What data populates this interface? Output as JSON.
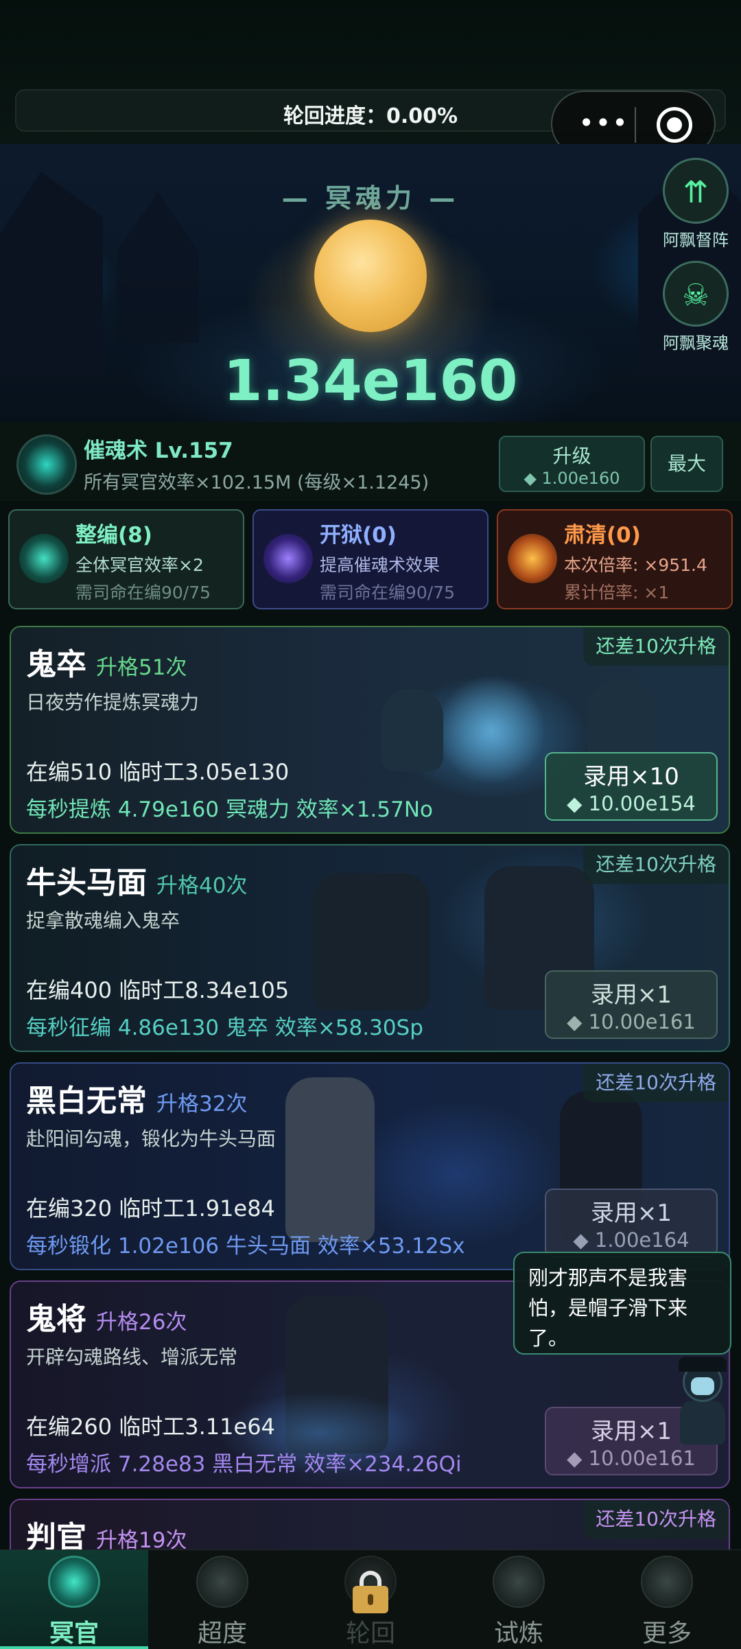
{
  "progress": {
    "text": "轮回进度：0.00%",
    "value": 0.0
  },
  "hero": {
    "title": "— 冥魂力 —",
    "value": "1.34e160"
  },
  "side_buttons": [
    {
      "label": "阿飘督阵",
      "icon": "arrows-up-icon"
    },
    {
      "label": "阿飘聚魂",
      "icon": "skull-icon"
    }
  ],
  "skill": {
    "title": "催魂术 Lv.157",
    "desc": "所有冥官效率×102.15M (每级×1.1245)",
    "upgrade_label": "升级",
    "upgrade_cost": "◆ 1.00e160",
    "max_label": "最大"
  },
  "modes": [
    {
      "name": "整编(8)",
      "line1": "全体冥官效率×2",
      "line2": "需司命在编90/75"
    },
    {
      "name": "开狱(0)",
      "line1": "提高催魂术效果",
      "line2": "需司命在编90/75"
    },
    {
      "name": "肃清(0)",
      "line1": "本次倍率: ×951.4",
      "line2": "累计倍率: ×1"
    }
  ],
  "units": [
    {
      "name": "鬼卒",
      "rank": "升格51次",
      "desc": "日夜劳作提炼冥魂力",
      "remain": "还差10次升格",
      "staff": "在编510  临时工3.05e130",
      "prod": "每秒提炼 4.79e160 冥魂力  效率×1.57No",
      "hire_label": "录用×10",
      "hire_cost": "◆ 10.00e154"
    },
    {
      "name": "牛头马面",
      "rank": "升格40次",
      "desc": "捉拿散魂编入鬼卒",
      "remain": "还差10次升格",
      "staff": "在编400  临时工8.34e105",
      "prod": "每秒征编 4.86e130 鬼卒  效率×58.30Sp",
      "hire_label": "录用×1",
      "hire_cost": "◆ 10.00e161"
    },
    {
      "name": "黑白无常",
      "rank": "升格32次",
      "desc": "赴阳间勾魂，锻化为牛头马面",
      "remain": "还差10次升格",
      "staff": "在编320  临时工1.91e84",
      "prod": "每秒锻化 1.02e106 牛头马面  效率×53.12Sx",
      "hire_label": "录用×1",
      "hire_cost": "◆ 1.00e164"
    },
    {
      "name": "鬼将",
      "rank": "升格26次",
      "desc": "开辟勾魂路线、增派无常",
      "remain": "",
      "staff": "在编260  临时工3.11e64",
      "prod": "每秒增派 7.28e83 黑白无常  效率×234.26Qi",
      "hire_label": "录用×1",
      "hire_cost": "◆ 10.00e161"
    },
    {
      "name": "判官",
      "rank": "升格19次",
      "remain": "还差10次升格"
    }
  ],
  "bubble": "刚才那声不是我害怕，是帽子滑下来了。",
  "nav": [
    {
      "label": "冥官",
      "icon": "ghost-officer-icon",
      "active": true
    },
    {
      "label": "超度",
      "icon": "lantern-icon"
    },
    {
      "label": "轮回",
      "icon": "lock-icon",
      "locked": true
    },
    {
      "label": "试炼",
      "icon": "flame-spirit-icon"
    },
    {
      "label": "更多",
      "icon": "more-spirit-icon"
    }
  ],
  "colors": {
    "accent": "#7ff0c4",
    "orb": "#f3c05c",
    "purple": "#b48cf0",
    "orange": "#ff9a4a"
  }
}
